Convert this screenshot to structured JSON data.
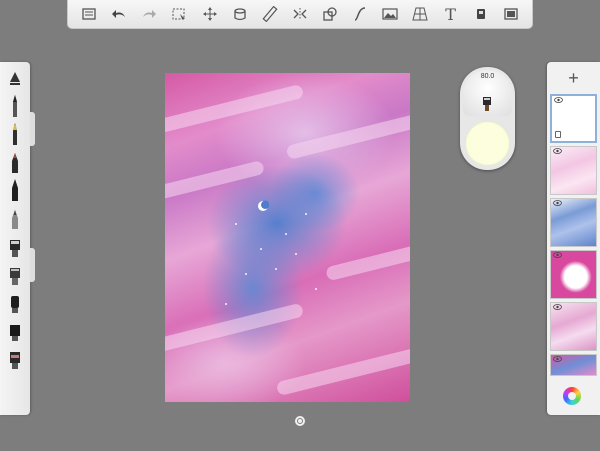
{
  "toolbar": {
    "items": [
      {
        "name": "menu-button",
        "icon": "menu-icon"
      },
      {
        "name": "undo-button",
        "icon": "undo-arrow-icon"
      },
      {
        "name": "redo-button",
        "icon": "redo-arrow-icon"
      },
      {
        "name": "selection-button",
        "icon": "selection-icon"
      },
      {
        "name": "transform-button",
        "icon": "move-icon"
      },
      {
        "name": "fill-button",
        "icon": "fill-icon"
      },
      {
        "name": "ruler-button",
        "icon": "ruler-icon"
      },
      {
        "name": "symmetry-button",
        "icon": "symmetry-icon"
      },
      {
        "name": "shapes-button",
        "icon": "shapes-icon"
      },
      {
        "name": "curve-button",
        "icon": "curve-icon"
      },
      {
        "name": "image-button",
        "icon": "image-icon"
      },
      {
        "name": "perspective-button",
        "icon": "perspective-icon"
      },
      {
        "name": "text-button",
        "icon": "text-icon"
      },
      {
        "name": "brush-settings-button",
        "icon": "brush-settings-icon"
      },
      {
        "name": "fullscreen-button",
        "icon": "fullscreen-icon"
      }
    ],
    "text_tool_label": "T"
  },
  "brush_library": {
    "brushes": [
      "eraser-icon",
      "pencil-icon",
      "marker-icon",
      "pen-icon",
      "ink-pen-icon",
      "airbrush-icon",
      "paint-brush-icon",
      "chisel-brush-icon",
      "smudge-icon",
      "wide-brush-icon",
      "stamp-icon"
    ]
  },
  "color_puck": {
    "brush_size": "80.0",
    "current_color": "#fdfede"
  },
  "layers": {
    "add_label": "+",
    "items": [
      {
        "name": "layer-1",
        "visible": true,
        "active": true
      },
      {
        "name": "layer-2",
        "visible": true,
        "active": false
      },
      {
        "name": "layer-3",
        "visible": true,
        "active": false
      },
      {
        "name": "layer-4",
        "visible": true,
        "active": false
      },
      {
        "name": "layer-5",
        "visible": true,
        "active": false
      },
      {
        "name": "layer-6",
        "visible": true,
        "active": false
      }
    ]
  },
  "colors": {
    "canvas_pink": "#d96db7",
    "canvas_blue": "#4e7dcd",
    "ui_background": "#7d7d7d"
  }
}
